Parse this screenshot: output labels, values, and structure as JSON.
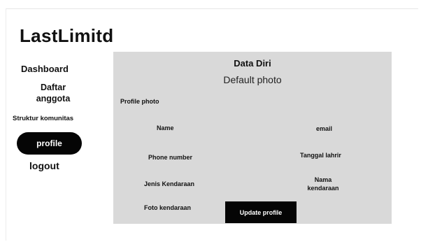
{
  "app": {
    "brand": "LastLimitd"
  },
  "sidebar": {
    "items": [
      {
        "label": "Dashboard"
      },
      {
        "label": "Daftar anggota"
      },
      {
        "label": "Struktur komunitas"
      },
      {
        "label": "profile",
        "active": true
      },
      {
        "label": "logout"
      }
    ]
  },
  "panel": {
    "title": "Data Diri",
    "photo_placeholder": "Default photo",
    "fields": {
      "profile_photo": "Profile photo",
      "name": "Name",
      "email": "email",
      "phone": "Phone number",
      "tanggal_lahir": "Tanggal lahrir",
      "jenis_kendaraan": "Jenis Kendaraan",
      "nama_kendaraan": "Nama kendaraan",
      "foto_kendaraan": "Foto kendaraan"
    },
    "update_button": "Update profile"
  },
  "colors": {
    "panel_bg": "#d9d9d9",
    "button_bg": "#050505",
    "button_text": "#ffffff"
  }
}
